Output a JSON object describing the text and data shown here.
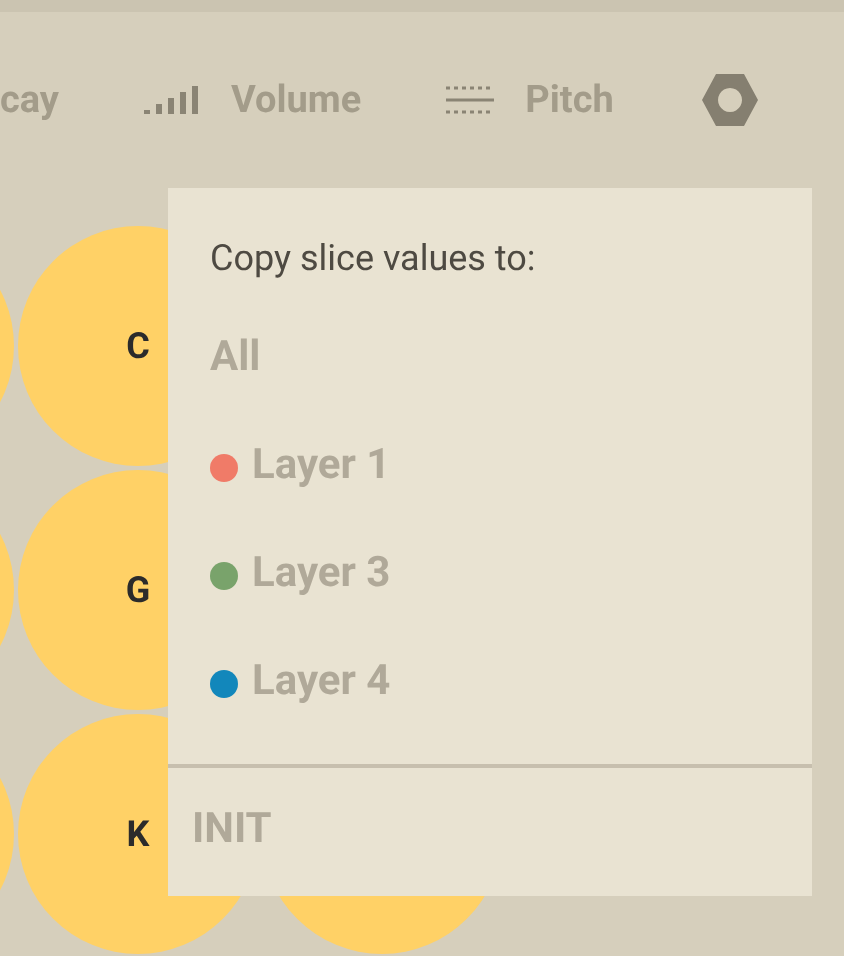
{
  "toolbar": {
    "tabs": [
      {
        "label": "cay",
        "kind": "none"
      },
      {
        "label": "Volume",
        "kind": "volume"
      },
      {
        "label": "Pitch",
        "kind": "pitch"
      }
    ]
  },
  "pads": [
    {
      "label": "C"
    },
    {
      "label": "G"
    },
    {
      "label": "K"
    }
  ],
  "menu": {
    "title": "Copy slice values to:",
    "items": [
      {
        "label": "All",
        "kind": "plain"
      },
      {
        "label": "Layer 1",
        "kind": "layer",
        "color": "#f07b68"
      },
      {
        "label": "Layer 3",
        "kind": "layer",
        "color": "#79a36b"
      },
      {
        "label": "Layer 4",
        "kind": "layer",
        "color": "#1287bb"
      }
    ],
    "footer": "INIT"
  }
}
